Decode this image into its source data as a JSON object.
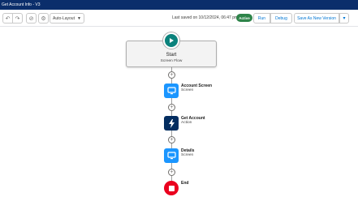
{
  "window": {
    "title": "Get Account Info - V3"
  },
  "toolbar": {
    "undo_icon": "undo-icon",
    "redo_icon": "redo-icon",
    "layout_select": "Auto-Layout",
    "last_saved": "Last saved on 10/12/2024, 06:47 pm",
    "status": "Active",
    "run": "Run",
    "debug": "Debug",
    "save_as": "Save As New Version"
  },
  "flow": {
    "start": {
      "title": "Start",
      "subtitle": "Screen Flow"
    },
    "nodes": [
      {
        "title": "Account Screen",
        "subtitle": "Screen",
        "icon": "screen-icon"
      },
      {
        "title": "Get Account",
        "subtitle": "Action",
        "icon": "lightning-icon"
      },
      {
        "title": "Details",
        "subtitle": "Screen",
        "icon": "screen-icon"
      }
    ],
    "end": {
      "title": "End"
    }
  },
  "colors": {
    "title_bar": "#0b2e6b",
    "start": "#0b827c",
    "screen": "#1b96ff",
    "action": "#032d60",
    "end": "#ea001e",
    "active_badge": "#2e844a",
    "link": "#0176d3"
  }
}
